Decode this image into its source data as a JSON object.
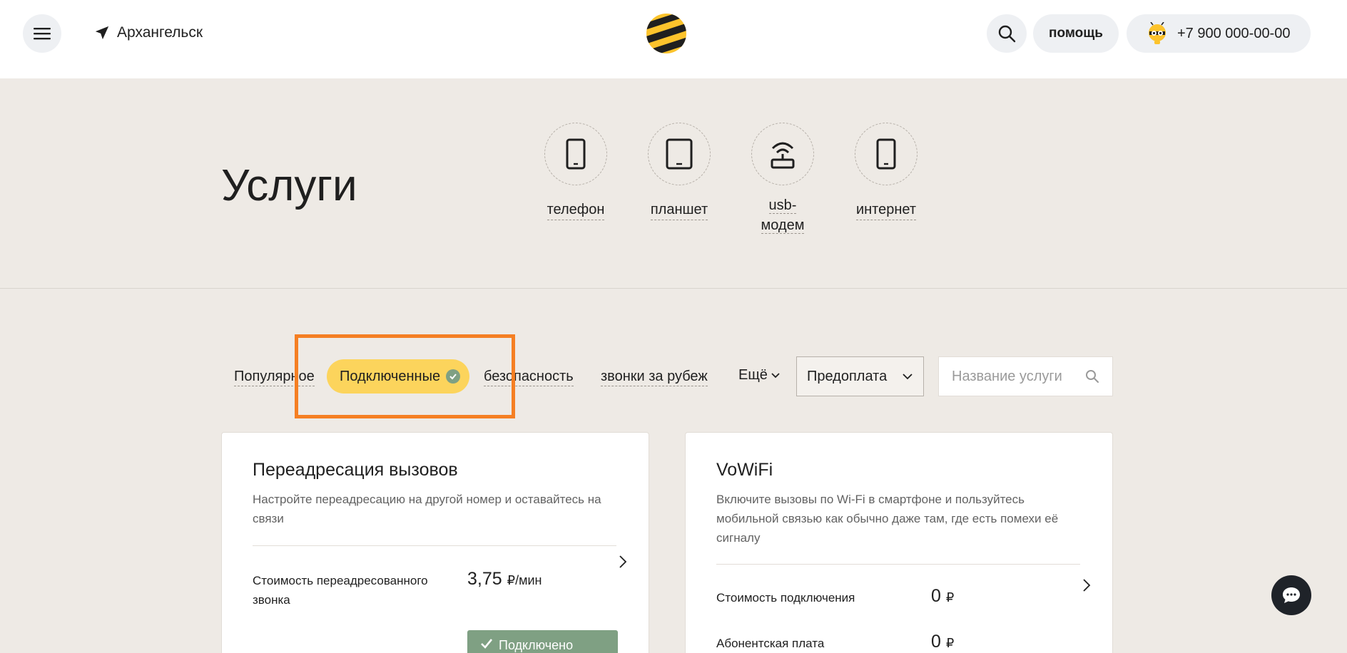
{
  "header": {
    "menu_icon": "hamburger-icon",
    "city": "Архангельск",
    "city_icon": "location-arrow-icon",
    "logo_icon": "beeline-logo",
    "search_icon": "search-icon",
    "help_label": "помощь",
    "phone_number": "+7 900 000-00-00",
    "avatar_icon": "bee-avatar-icon"
  },
  "hero": {
    "title": "Услуги",
    "devices": [
      {
        "label": "телефон",
        "icon": "phone-icon"
      },
      {
        "label": "планшет",
        "icon": "tablet-icon"
      },
      {
        "label": "usb-модем",
        "label_line1": "usb-",
        "label_line2": "модем",
        "icon": "router-icon"
      },
      {
        "label": "интернет",
        "icon": "phone-icon"
      }
    ]
  },
  "filters": {
    "tabs": [
      "Популярное",
      "Подключенные",
      "безопасность",
      "звонки за рубеж"
    ],
    "active_tab": "Подключенные",
    "more_label": "Ещё",
    "plan_select": "Предоплата",
    "search_placeholder": "Название услуги"
  },
  "cards": [
    {
      "title": "Переадресация вызовов",
      "description": "Настройте переадресацию на другой номер и оставайтесь на связи",
      "rows": [
        {
          "label": "Стоимость переадресованного звонка",
          "value": "3,75",
          "unit": "₽/мин"
        }
      ],
      "status_button": "Подключено"
    },
    {
      "title": "VoWiFi",
      "description": "Включите вызовы по Wi-Fi в смартфоне и пользуйтесь мобильной связью как обычно даже там, где есть помехи её сигналу",
      "rows": [
        {
          "label": "Стоимость подключения",
          "value": "0",
          "unit": "₽"
        },
        {
          "label": "Абонентская плата",
          "value": "0",
          "unit": "₽"
        }
      ]
    }
  ],
  "colors": {
    "accent_yellow": "#fcd45c",
    "connected_green": "#7fa083",
    "highlight_orange": "#f57f23",
    "page_bg": "#eeeae5"
  },
  "chat_icon": "chat-bubble-icon"
}
